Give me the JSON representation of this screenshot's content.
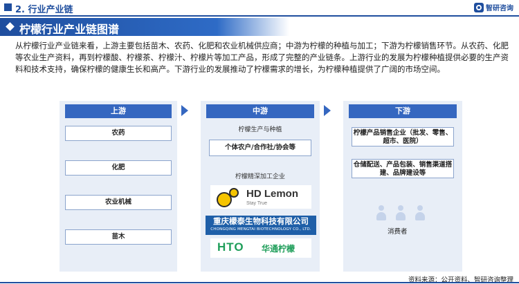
{
  "header": {
    "section": "2. 行业产业链",
    "brand": "智研咨询"
  },
  "banner": {
    "title": "柠檬行业产业链图谱"
  },
  "description": "从柠檬行业产业链来看，上游主要包括苗木、农药、化肥和农业机械供应商；中游为柠檬的种植与加工；下游为柠檬销售环节。从农药、化肥等农业生产资料，再到柠檬酸、柠檬茶、柠檬汁、柠檬片等加工产品，形成了完整的产业链条。上游行业的发展为柠檬种植提供必要的生产资料和技术支持，确保柠檬的健康生长和高产。下游行业的发展推动了柠檬需求的增长，为柠檬种植提供了广阔的市场空间。",
  "upstream": {
    "label": "上游",
    "items": [
      "农药",
      "化肥",
      "农业机械",
      "苗木"
    ]
  },
  "midstream": {
    "label": "中游",
    "planting_label": "柠檬生产与种植",
    "planting_box": "个体农户/合作社/协会等",
    "processing_label": "柠檬精深加工企业",
    "logos": {
      "hd_name": "HD Lemon",
      "hd_slogan": "Stay True",
      "mengtai_cn": "重庆檬泰生物科技有限公司",
      "mengtai_en": "CHONGQING MENGTAI BIOTECHNOLOGY CO., LTD.",
      "hto_mark": "HTO",
      "hto_cn": "华通柠檬"
    }
  },
  "downstream": {
    "label": "下游",
    "items": [
      "柠檬产品销售企业（批发、零售、超市、医院）",
      "仓储配送、产品包装、销售渠道搭建、品牌建设等"
    ],
    "consumer_label": "消费者"
  },
  "footer": {
    "source": "资料来源：公开资料、智研咨询整理"
  }
}
